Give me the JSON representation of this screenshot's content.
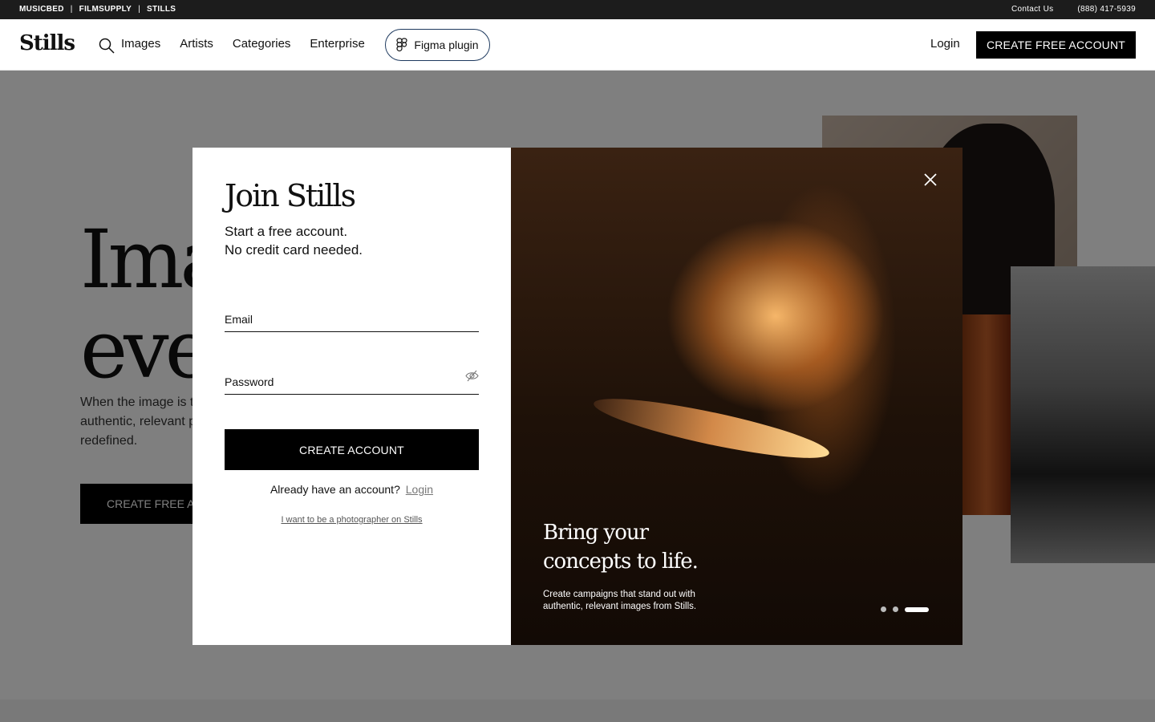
{
  "topbar": {
    "brands": [
      "MUSICBED",
      "FILMSUPPLY",
      "STILLS"
    ],
    "separator": "|",
    "contact": "Contact Us",
    "phone": "(888) 417-5939"
  },
  "nav": {
    "logo": "Stills",
    "links": [
      "Images",
      "Artists",
      "Categories",
      "Enterprise"
    ],
    "figma_plugin": "Figma plugin",
    "login": "Login",
    "create_free_account": "CREATE FREE ACCOUNT"
  },
  "hero": {
    "title_line1": "Ima",
    "title_line2": "eve",
    "subtitle_line1": "When the image is t",
    "subtitle_line2": "authentic, relevant p",
    "subtitle_line3": "redefined.",
    "cta": "CREATE FREE AC"
  },
  "modal": {
    "title": "Join Stills",
    "subtitle_line1": "Start a free account.",
    "subtitle_line2": "No credit card needed.",
    "email_label": "Email",
    "password_label": "Password",
    "create_account": "CREATE ACCOUNT",
    "already_text": "Already have an account?",
    "login_link": "Login",
    "photographer_link": "I want to be a photographer on Stills",
    "promo_title_line1": "Bring your",
    "promo_title_line2": "concepts to life.",
    "promo_text": "Create campaigns that stand out with authentic, relevant images from Stills.",
    "carousel": {
      "total": 3,
      "active": 3
    }
  }
}
